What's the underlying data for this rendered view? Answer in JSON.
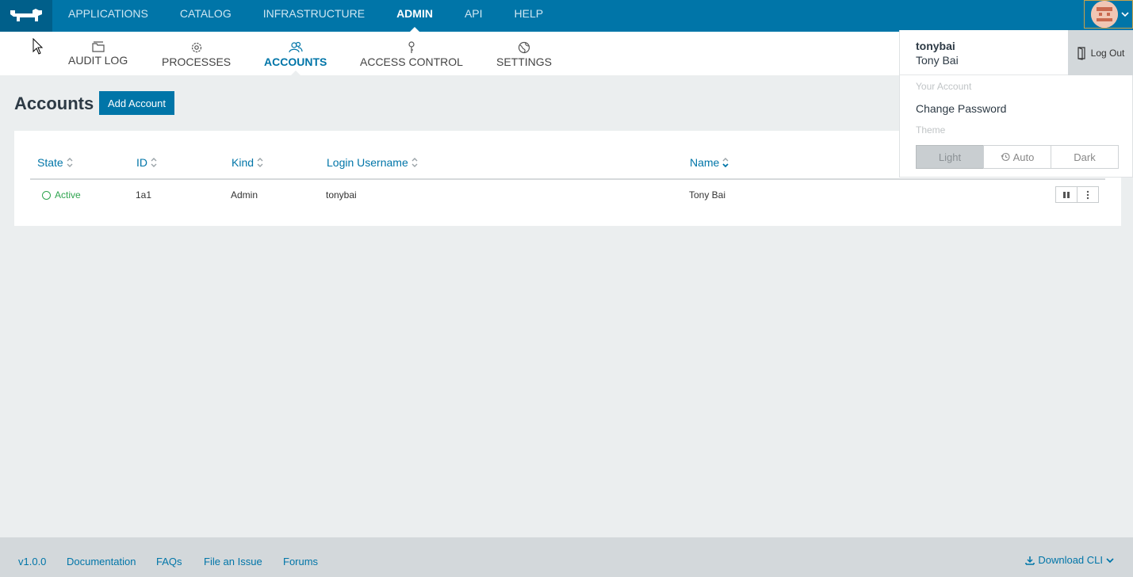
{
  "topnav": {
    "items": [
      {
        "label": "APPLICATIONS"
      },
      {
        "label": "CATALOG"
      },
      {
        "label": "INFRASTRUCTURE"
      },
      {
        "label": "ADMIN",
        "active": true
      },
      {
        "label": "API"
      },
      {
        "label": "HELP"
      }
    ]
  },
  "subnav": {
    "items": [
      {
        "label": "AUDIT LOG",
        "icon": "folder-icon"
      },
      {
        "label": "PROCESSES",
        "icon": "gear-icon"
      },
      {
        "label": "ACCOUNTS",
        "icon": "users-icon",
        "active": true
      },
      {
        "label": "ACCESS CONTROL",
        "icon": "key-icon"
      },
      {
        "label": "SETTINGS",
        "icon": "globe-icon"
      }
    ]
  },
  "page": {
    "title": "Accounts",
    "add_button": "Add Account"
  },
  "table": {
    "columns": [
      "State",
      "ID",
      "Kind",
      "Login Username",
      "Name"
    ],
    "rows": [
      {
        "state": "Active",
        "id": "1a1",
        "kind": "Admin",
        "username": "tonybai",
        "name": "Tony Bai"
      }
    ]
  },
  "user_menu": {
    "username": "tonybai",
    "name": "Tony Bai",
    "logout": "Log Out",
    "your_account_label": "Your Account",
    "change_password": "Change Password",
    "theme_label": "Theme",
    "themes": [
      "Light",
      "Auto",
      "Dark"
    ],
    "selected_theme": "Light"
  },
  "footer": {
    "version": "v1.0.0",
    "links": [
      "Documentation",
      "FAQs",
      "File an Issue",
      "Forums"
    ],
    "download_cli": "Download CLI"
  },
  "colors": {
    "brand": "#0075a8",
    "active_state": "#2ea44f",
    "background": "#ebeeef"
  }
}
